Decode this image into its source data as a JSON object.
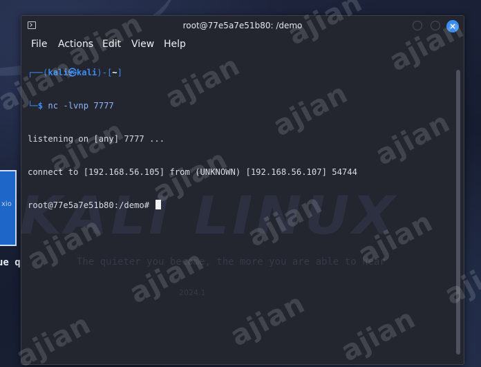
{
  "desktop": {
    "side_text": "xio",
    "tagline": "ue q"
  },
  "window": {
    "title": "root@77e5a7e51b80: /demo",
    "close_symbol": "×"
  },
  "menu": {
    "items": [
      "File",
      "Actions",
      "Edit",
      "View",
      "Help"
    ]
  },
  "terminal": {
    "prompt_top": {
      "corner": "┌──",
      "open": "(",
      "user": "kali",
      "at": "㉿",
      "host": "kali",
      "close": ")",
      "dash": "-",
      "dir_open": "[",
      "dir": "~",
      "dir_close": "]"
    },
    "prompt_bottom": {
      "corner": "└─",
      "dollar": "$ ",
      "command": "nc -lvnp 7777"
    },
    "output": [
      "listening on [any] 7777 ...",
      "connect to [192.168.56.105] from (UNKNOWN) [192.168.56.107] 54744"
    ],
    "shell_prompt": "root@77e5a7e51b80:/demo# ",
    "background_logo": "KALI LINUX",
    "background_tagline": "The quieter you become, the more you are able to hear",
    "background_version": "2024.1"
  },
  "watermark": {
    "text": "ajian"
  }
}
